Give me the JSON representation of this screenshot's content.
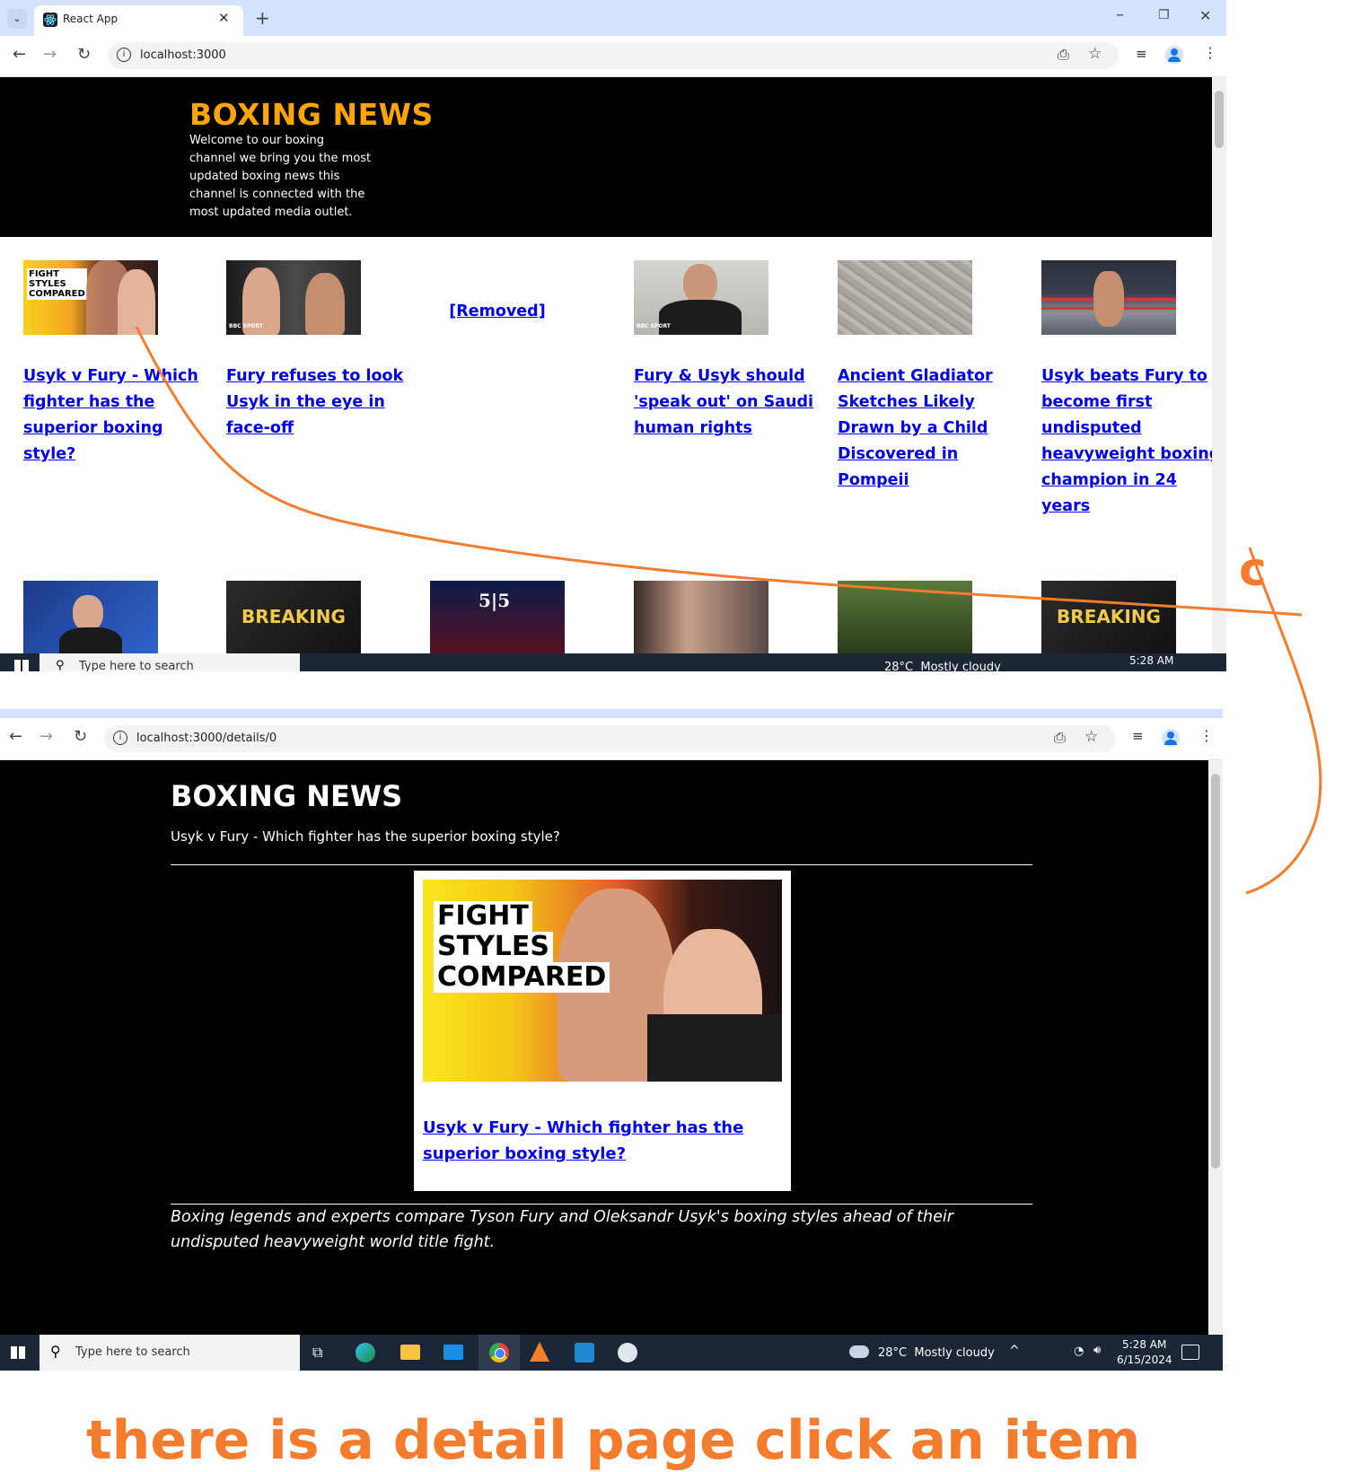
{
  "colors": {
    "accent_orange": "#f47c2c",
    "header_title": "#ffa500",
    "link": "#0000ee",
    "taskbar": "#1b2737",
    "tabstrip": "#d3e3fd"
  },
  "window1": {
    "tab_title": "React App",
    "url": "localhost:3000",
    "header": {
      "title": "BOXING NEWS",
      "description": "Welcome to our boxing channel we bring you the most updated boxing news this channel is connected with the most updated media outlet."
    },
    "cards": [
      {
        "title": "Usyk v Fury - Which fighter has the superior boxing style?",
        "image": "fight-styles-compared"
      },
      {
        "title": "Fury refuses to look Usyk in the eye in face-off",
        "image": "fury-usyk-faceoff"
      },
      {
        "title": "",
        "removed_label": "[Removed]"
      },
      {
        "title": "Fury & Usyk should 'speak out' on Saudi human rights",
        "image": "fury-portrait"
      },
      {
        "title": "Ancient Gladiator Sketches Likely Drawn by a Child Discovered in Pompeii",
        "image": "wall-sketches"
      },
      {
        "title": "Usyk beats Fury to become first undisputed heavyweight boxing champion in 24 years",
        "image": "boxing-ring"
      }
    ],
    "row2_images": [
      "fighter-celebrating",
      "breaking",
      "555-event",
      "punch-exchange",
      "fury-selfie",
      "breaking"
    ],
    "breaking_label": "BREAKING",
    "taskbar": {
      "search_placeholder": "Type here to search",
      "weather": "28°C  Mostly cloudy",
      "time": "5:28 AM"
    }
  },
  "window2": {
    "url": "localhost:3000/details/0",
    "title": "BOXING NEWS",
    "subtitle": "Usyk v Fury - Which fighter has the superior boxing style?",
    "image_text": [
      "FIGHT",
      "STYLES",
      "COMPARED"
    ],
    "link": "Usyk v Fury - Which fighter has the superior boxing style?",
    "description": "Boxing legends and experts compare Tyson Fury and Oleksandr Usyk's boxing styles ahead of their undisputed heavyweight world title fight.",
    "taskbar": {
      "search_placeholder": "Type here to search",
      "weather": "28°C  Mostly cloudy",
      "time": "5:28 AM",
      "date": "6/15/2024"
    }
  },
  "annotation": {
    "letter": "c",
    "caption": "there is a detail page click an item"
  }
}
